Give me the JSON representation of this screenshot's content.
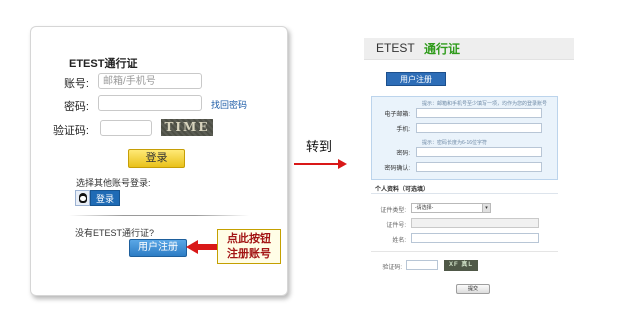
{
  "login": {
    "title": "ETEST通行证",
    "account_label": "账号:",
    "account_placeholder": "邮箱/手机号",
    "password_label": "密码:",
    "recover_password_link": "找回密码",
    "captcha_label": "验证码:",
    "captcha_image_text": "TIME",
    "login_button": "登录",
    "other_accounts_label": "选择其他账号登录:",
    "qq_login_button": "登录",
    "no_account_text": "没有ETEST通行证?",
    "register_button": "用户注册"
  },
  "callout": {
    "line1": "点此按钮",
    "line2": "注册账号"
  },
  "transition": {
    "label": "转到"
  },
  "register": {
    "header_title_a": "ETEST",
    "header_title_b": "通行证",
    "tab_label": "用户注册",
    "hint_email": "提示：邮箱和手机号至少填写一项，均作为您的登录账号",
    "email_label": "电子邮箱:",
    "phone_label": "手机:",
    "hint_password": "提示：密码长度为6-16位字符",
    "password_label": "密码:",
    "confirm_password_label": "密码确认:",
    "personal_section": "个人资料（可选填）",
    "id_type_label": "证件类型:",
    "id_type_selected": "-请选择-",
    "id_number_label": "证件号:",
    "name_label": "姓名:",
    "captcha_label": "验证码:",
    "captcha_image_text": "XF 真L",
    "submit_button": "提交"
  },
  "colors": {
    "login_button": "#f2d138",
    "register_button": "#2d7cc4",
    "callout_text": "#a31515",
    "arrow": "#d91818",
    "brand_green": "#2f9b1b"
  }
}
